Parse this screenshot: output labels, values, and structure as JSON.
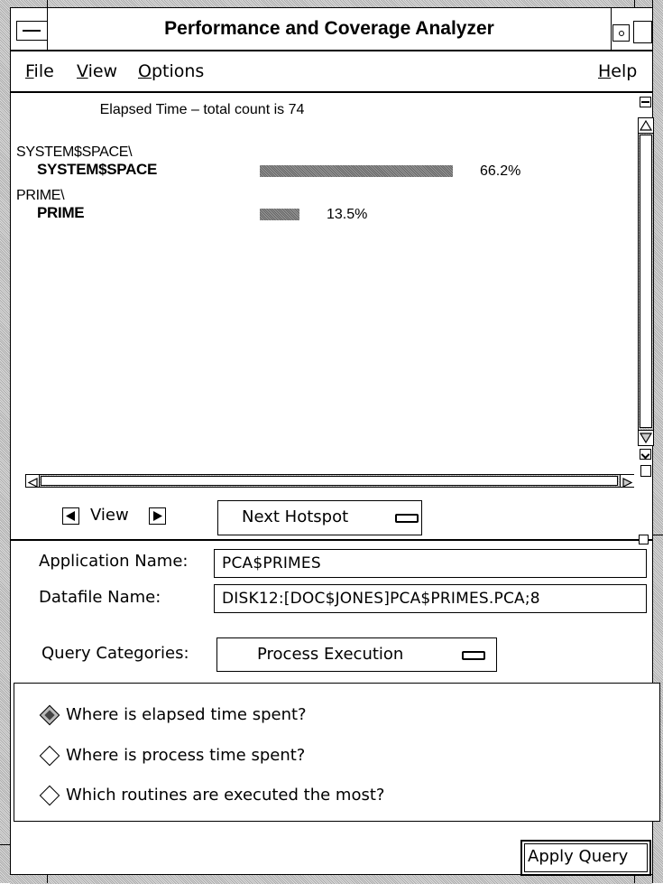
{
  "window": {
    "title": "Performance and Coverage Analyzer"
  },
  "menubar": {
    "file": "File",
    "view": "View",
    "options": "Options",
    "help": "Help"
  },
  "chart": {
    "title": "Elapsed Time – total count is 74",
    "rows": [
      {
        "group": "SYSTEM$SPACE\\",
        "name": "SYSTEM$SPACE",
        "percent_label": "66.2%"
      },
      {
        "group": "PRIME\\",
        "name": "PRIME",
        "percent_label": "13.5%"
      }
    ]
  },
  "chart_data": {
    "type": "bar",
    "title": "Elapsed Time – total count is 74",
    "categories": [
      "SYSTEM$SPACE",
      "PRIME"
    ],
    "values": [
      66.2,
      13.5
    ],
    "unit": "%"
  },
  "view_controls": {
    "view_label": "View",
    "next_hotspot_label": "Next Hotspot"
  },
  "form": {
    "application_name_label": "Application Name:",
    "application_name_value": "PCA$PRIMES",
    "datafile_name_label": "Datafile Name:",
    "datafile_name_value": "DISK12:[DOC$JONES]PCA$PRIMES.PCA;8",
    "query_categories_label": "Query Categories:",
    "query_categories_value": "Process Execution"
  },
  "queries": [
    {
      "label": "Where is elapsed time spent?",
      "selected": true
    },
    {
      "label": "Where is process time spent?",
      "selected": false
    },
    {
      "label": "Which routines are executed the most?",
      "selected": false
    }
  ],
  "apply_query_label": "Apply Query",
  "icons": {
    "window_menu": "window-menu-icon",
    "minimize": "minimize-icon",
    "maximize": "maximize-icon",
    "view_prev": "triangle-left-icon",
    "view_next": "triangle-right-icon",
    "option_menu": "option-menu-indicator-icon"
  }
}
